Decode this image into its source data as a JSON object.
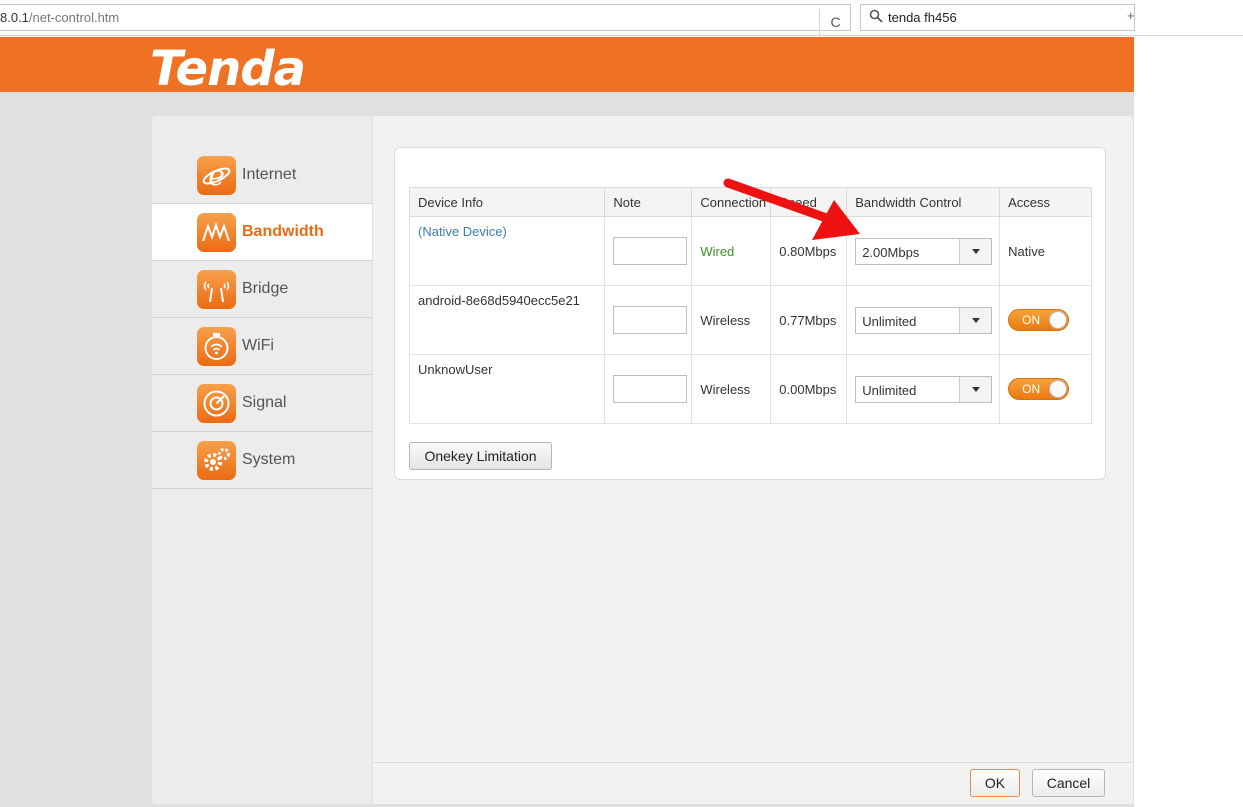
{
  "browser": {
    "url": "8.0.1",
    "url_path": "/net-control.htm",
    "reload": "C",
    "search_value": "tenda fh456",
    "new_tab": "+"
  },
  "brand": {
    "logo": "Tenda",
    "accent": "#ee7124"
  },
  "sidebar": {
    "items": [
      {
        "label": "Internet",
        "icon": "internet-explorer-icon"
      },
      {
        "label": "Bandwidth",
        "icon": "bandwidth-wave-icon",
        "active": true
      },
      {
        "label": "Bridge",
        "icon": "bridge-antenna-icon"
      },
      {
        "label": "WiFi",
        "icon": "wifi-timer-icon"
      },
      {
        "label": "Signal",
        "icon": "signal-gauge-icon"
      },
      {
        "label": "System",
        "icon": "system-gear-icon"
      }
    ]
  },
  "table": {
    "headers": {
      "device": "Device Info",
      "note": "Note",
      "connection": "Connection",
      "speed": "Speed",
      "bandwidth": "Bandwidth Control",
      "access": "Access"
    },
    "rows": [
      {
        "device": "(Native Device)",
        "connection": "Wired",
        "speed": "0.80Mbps",
        "bandwidth": "2.00Mbps",
        "access": "Native"
      },
      {
        "device": "android-8e68d5940ecc5e21",
        "connection": "Wireless",
        "speed": "0.77Mbps",
        "bandwidth": "Unlimited",
        "access": "ON"
      },
      {
        "device": "UnknowUser",
        "connection": "Wireless",
        "speed": "0.00Mbps",
        "bandwidth": "Unlimited",
        "access": "ON"
      }
    ]
  },
  "buttons": {
    "onekey": "Onekey Limitation",
    "ok": "OK",
    "cancel": "Cancel"
  },
  "colors": {
    "link": "#3d7db3",
    "wired": "#3a8f2a",
    "toggle_on": "#eb7a10",
    "annotation_arrow": "#ee1111"
  }
}
